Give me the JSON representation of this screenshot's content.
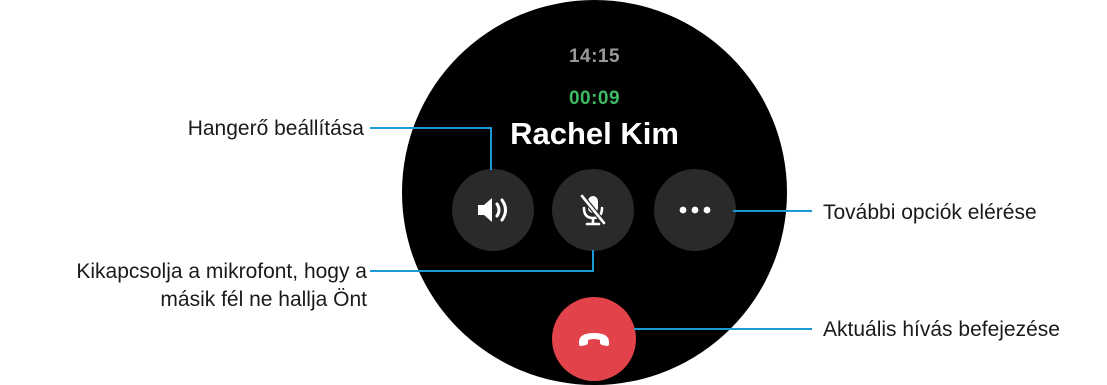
{
  "watch": {
    "clock": "14:15",
    "call_duration": "00:09",
    "caller_name": "Rachel Kim"
  },
  "buttons": {
    "volume_icon": "speaker-volume-icon",
    "mute_icon": "microphone-muted-icon",
    "more_icon": "more-options-icon",
    "end_icon": "phone-hangup-icon"
  },
  "callouts": {
    "volume": "Hangerő beállítása",
    "mute_line1": "Kikapcsolja a mikrofont, hogy a",
    "mute_line2": "másik fél ne hallja Önt",
    "more": "További opciók elérése",
    "end": "Aktuális hívás befejezése"
  },
  "colors": {
    "watch_background": "#000000",
    "button_background": "#2a2a2a",
    "end_call": "#e2434b",
    "duration": "#3dba63",
    "callout_line": "#1a9ad6"
  }
}
